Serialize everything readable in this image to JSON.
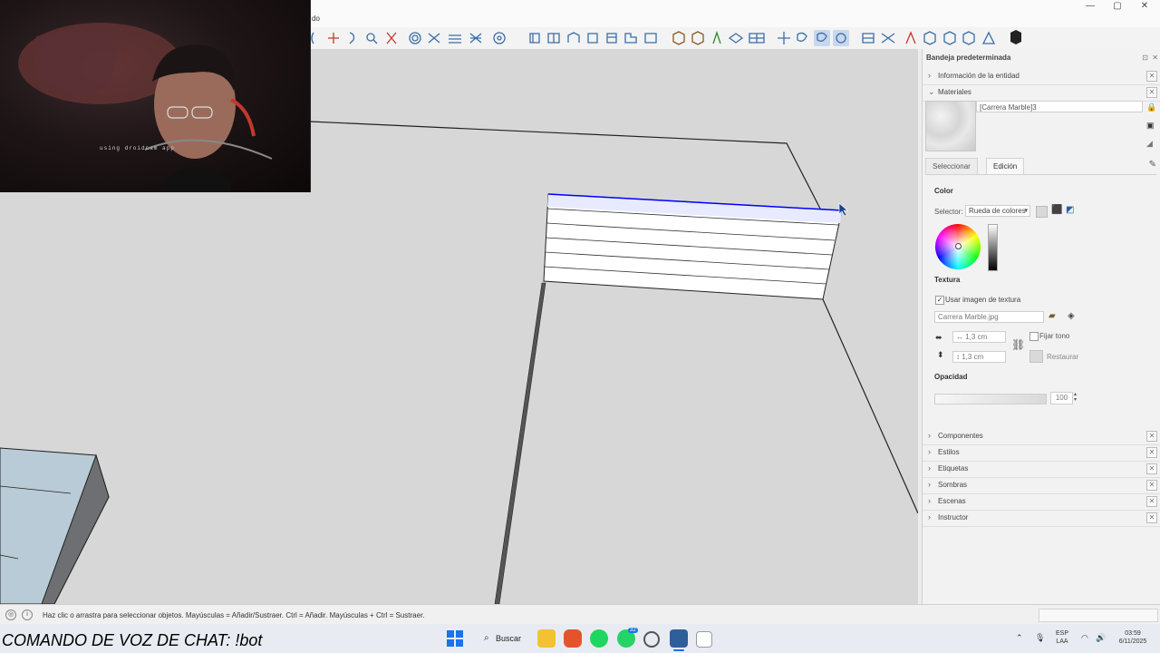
{
  "title_menu_fragment": "do",
  "window_controls": [
    "—",
    "▢",
    "✕"
  ],
  "tray_panel": {
    "title": "Bandeja predeterminada",
    "entity_info_label": "Información de la entidad",
    "materials_label": "Materiales",
    "material_name": "[Carrera Marble]3",
    "tabs": [
      "Seleccionar",
      "Edición"
    ],
    "color_heading": "Color",
    "selector_label": "Selector:",
    "selector_value": "Rueda de colores",
    "texture_heading": "Textura",
    "use_texture_label": "Usar imagen de textura",
    "use_texture_checked": true,
    "texture_file": "Carrera Marble.jpg",
    "width_value": "1,3 cm",
    "height_value": "1,3 cm",
    "fix_hue_label": "Fijar tono",
    "reset_label": "Restaurar",
    "opacity_heading": "Opacidad",
    "opacity_value": "100",
    "collapsed_sections": [
      "Componentes",
      "Estilos",
      "Etiquetas",
      "Sombras",
      "Escenas",
      "Instructor"
    ]
  },
  "statusbar": {
    "hint": "Haz clic o arrastra para seleccionar objetos. Mayúsculas = Añadir/Sustraer. Ctrl = Añadir. Mayúsculas + Ctrl = Sustraer."
  },
  "taskbar": {
    "overlay_caption": "COMANDO DE VOZ DE CHAT: !bot",
    "search_label": "Buscar",
    "language_top": "ESP",
    "language_bottom": "LAA",
    "time": "03:59",
    "date": "6/11/2025",
    "whatsapp_badge": "32"
  },
  "webcam": {
    "overlay_text": "using droidcam app"
  },
  "colors": {
    "accent_blue": "#0000ff",
    "panel_bg": "#f2f2f2",
    "viewport_bg": "#d7d7d7"
  }
}
